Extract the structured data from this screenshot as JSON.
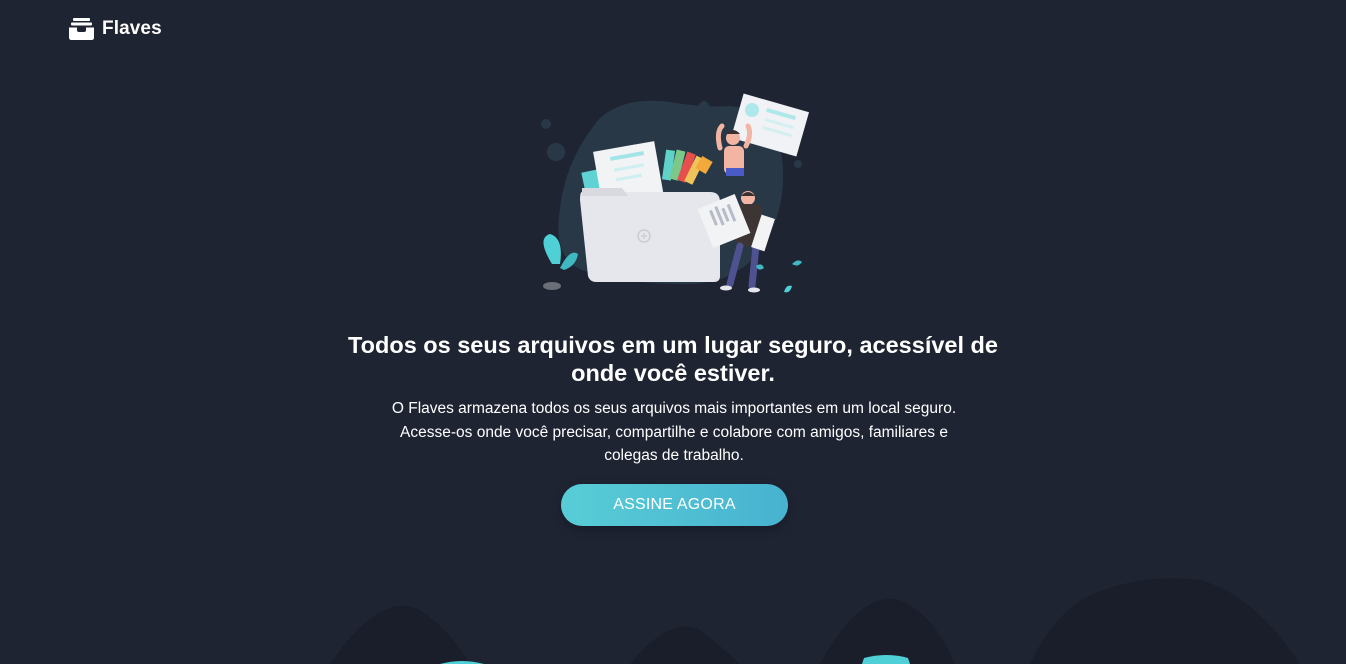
{
  "brand": {
    "name": "Flaves",
    "icon": "inbox-tray-icon"
  },
  "hero": {
    "title": "Todos os seus arquivos em um lugar seguro, acessível de onde você estiver.",
    "subtitle_lines": [
      "O Flaves armazena todos os seus arquivos mais importantes em um local seguro.",
      "Acesse-os onde você precisar, compartilhe e colabore com amigos, familiares e",
      "colegas de trabalho."
    ],
    "cta_label": "ASSINE AGORA"
  },
  "colors": {
    "background": "#1f2433",
    "hills": "#1a1e2b",
    "accent": "#52c3d4",
    "accent_end": "#48b2d0",
    "text": "#ffffff"
  }
}
